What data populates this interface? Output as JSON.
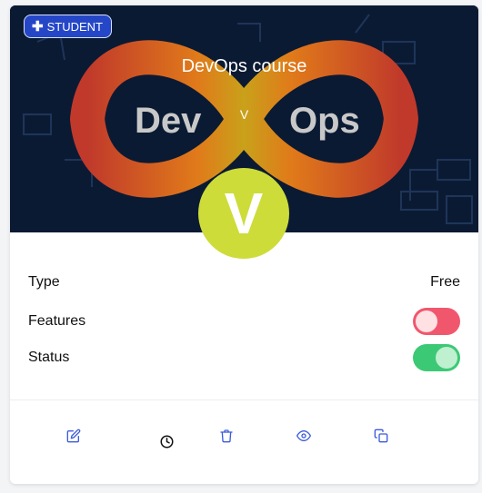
{
  "badge": {
    "label": "STUDENT"
  },
  "course": {
    "title": "DevOps course",
    "subtitle": "V"
  },
  "avatar": {
    "letter": "V",
    "color": "#cddc39"
  },
  "banner": {
    "words": [
      "Dev",
      "Ops"
    ]
  },
  "details": {
    "type_label": "Type",
    "type_value": "Free",
    "features_label": "Features",
    "features_on": false,
    "status_label": "Status",
    "status_on": true
  },
  "actions": [
    "edit-icon",
    "clock-icon",
    "trash-icon",
    "eye-icon",
    "copy-icon"
  ],
  "colors": {
    "badge": "#2547c7",
    "action_icon": "#3b5bdb",
    "toggle_off": "#f0576d",
    "toggle_on": "#3cc976"
  }
}
